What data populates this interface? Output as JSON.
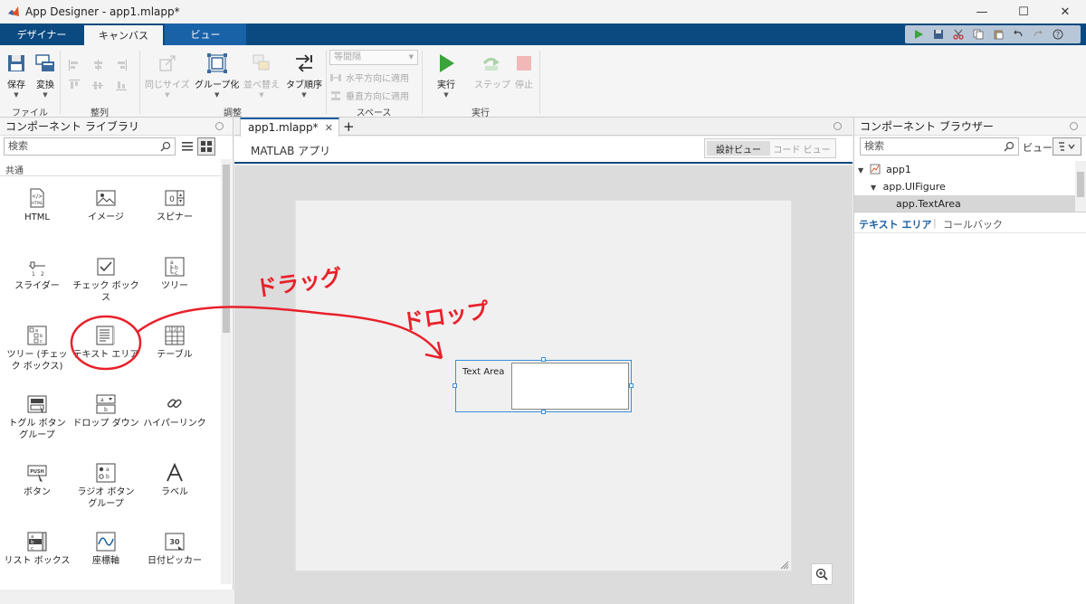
{
  "window": {
    "title": "App Designer - app1.mlapp*",
    "minimize": "—",
    "maximize": "☐",
    "close": "✕"
  },
  "ribbon_tabs": [
    {
      "label": "デザイナー"
    },
    {
      "label": "キャンバス"
    },
    {
      "label": "ビュー"
    }
  ],
  "ribbon": {
    "save": "保存",
    "convert": "変換",
    "same_size": "同じサイズ",
    "group": "グループ化",
    "reorder": "並べ替え",
    "tab_order": "タブ順序",
    "spacing_select": "等間隔",
    "apply_horizontal": "水平方向に適用",
    "apply_vertical": "垂直方向に適用",
    "run": "実行",
    "step": "ステップ",
    "stop": "停止",
    "groups": {
      "file": "ファイル",
      "align": "整列",
      "arrange": "調整",
      "space": "スペース",
      "run": "実行"
    }
  },
  "left_panel": {
    "title": "コンポーネント ライブラリ",
    "search_placeholder": "検索",
    "category": "共通",
    "components": [
      {
        "label": "HTML"
      },
      {
        "label": "イメージ"
      },
      {
        "label": "スピナー"
      },
      {
        "label": "スライダー"
      },
      {
        "label": "チェック ボックス"
      },
      {
        "label": "ツリー"
      },
      {
        "label": "ツリー (チェック ボックス)"
      },
      {
        "label": "テキスト エリア"
      },
      {
        "label": "テーブル"
      },
      {
        "label": "トグル ボタン グループ"
      },
      {
        "label": "ドロップ ダウン"
      },
      {
        "label": "ハイパーリンク"
      },
      {
        "label": "ボタン"
      },
      {
        "label": "ラジオ ボタン グループ"
      },
      {
        "label": "ラベル"
      },
      {
        "label": "リスト ボックス"
      },
      {
        "label": "座標軸"
      },
      {
        "label": "日付ピッカー"
      }
    ]
  },
  "editor": {
    "tab_label": "app1.mlapp*",
    "app_label": "MATLAB アプリ",
    "design_view": "設計ビュー",
    "code_view": "コード ビュー",
    "text_area_label": "Text Area"
  },
  "right_panel": {
    "title": "コンポーネント ブラウザー",
    "search_placeholder": "検索",
    "view_label": "ビュー:",
    "tree": [
      {
        "label": "app1"
      },
      {
        "label": "app.UIFigure"
      },
      {
        "label": "app.TextArea"
      }
    ],
    "tabs": {
      "text_area": "テキスト エリア",
      "callbacks": "コールバック"
    }
  },
  "annotations": {
    "drag": "ドラッグ",
    "drop": "ドロップ"
  },
  "colors": {
    "accent": "#0a4a80",
    "annotation": "#e8212b",
    "selection": "#3d8edb"
  }
}
